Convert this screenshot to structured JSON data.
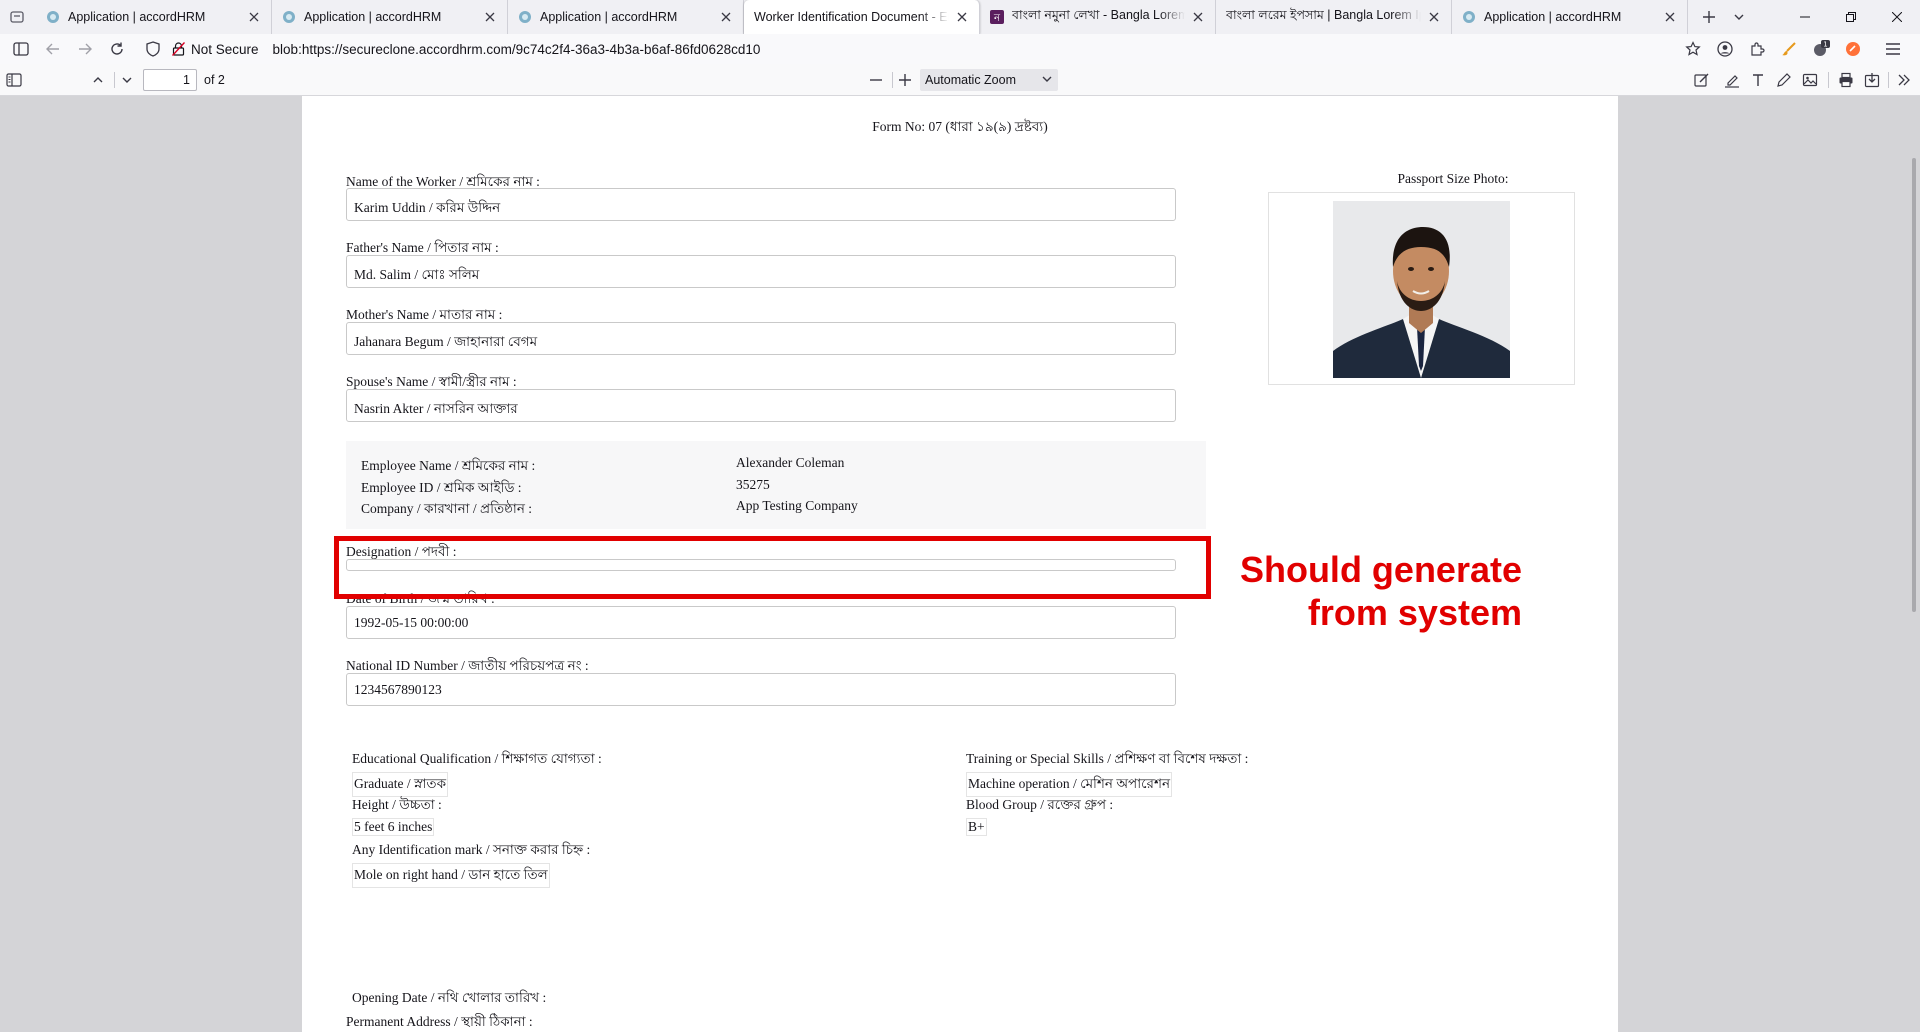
{
  "tabs": [
    {
      "title": "Application | accordHRM",
      "icon": "accordhrm-favicon-icon",
      "active": false
    },
    {
      "title": "Application | accordHRM",
      "icon": "accordhrm-favicon-icon",
      "active": false
    },
    {
      "title": "Application | accordHRM",
      "icon": "accordhrm-favicon-icon",
      "active": false
    },
    {
      "title": "Worker Identification Document - Emp",
      "icon": "",
      "active": true
    },
    {
      "title": "বাংলা নমুনা লেখা - Bangla Lorem I",
      "icon": "bangla-site-favicon-icon",
      "active": false
    },
    {
      "title": "বাংলা লরেম ইপসাম | Bangla Lorem Ip",
      "icon": "",
      "active": false
    },
    {
      "title": "Application | accordHRM",
      "icon": "accordhrm-favicon-icon",
      "active": false
    }
  ],
  "navbar": {
    "security_label": "Not Secure",
    "url": "blob:https://secureclone.accordhrm.com/9c74c2f4-36a3-4b3a-b6af-86fd0628cd10",
    "extension_badge": "1"
  },
  "pdf_toolbar": {
    "page_number": "1",
    "page_count": "of 2",
    "zoom": "Automatic Zoom"
  },
  "document": {
    "form_number": "Form No: 07 (ধারা ১৯(৯) দ্রষ্টব্য)",
    "worker_name_label": "Name of the Worker / শ্রমিকের নাম :",
    "worker_name": "Karim Uddin / করিম উদ্দিন",
    "father_label": "Father's Name / পিতার নাম :",
    "father_name": "Md. Salim / মোঃ সলিম",
    "mother_label": "Mother's Name / মাতার নাম :",
    "mother_name": "Jahanara Begum / জাহানারা বেগম",
    "spouse_label": "Spouse's Name / স্বামী/স্ত্রীর নাম :",
    "spouse_name": "Nasrin Akter / নাসরিন আক্তার",
    "photo_label": "Passport Size Photo:",
    "employee_name_label": "Employee Name / শ্রমিকের নাম :",
    "employee_name": "Alexander Coleman",
    "employee_id_label": "Employee ID / শ্রমিক আইডি :",
    "employee_id": "35275",
    "company_label": "Company / কারখানা / প্রতিষ্ঠান :",
    "company": "App Testing Company",
    "designation_label": "Designation / পদবী :",
    "designation": "",
    "dob_label": "Date of Birth / জন্ম তারিখ :",
    "dob": "1992-05-15 00:00:00",
    "nid_label": "National ID Number / জাতীয় পরিচয়পত্র নং :",
    "nid": "1234567890123",
    "education_label": "Educational Qualification / শিক্ষাগত যোগ্যতা :",
    "education": "Graduate / স্নাতক",
    "training_label": "Training or Special Skills / প্রশিক্ষণ বা বিশেষ দক্ষতা :",
    "training": "Machine operation / মেশিন অপারেশন",
    "height_label": "Height / উচ্চতা :",
    "height": "5 feet 6 inches",
    "blood_label": "Blood Group / রক্তের গ্রুপ :",
    "blood": "B+",
    "mark_label": "Any Identification mark / সনাক্ত করার চিহ্ন :",
    "mark": "Mole on right hand / ডান হাতে তিল",
    "opening_date_label": "Opening Date / নথি খোলার তারিখ :",
    "permanent_address_label": "Permanent Address / স্থায়ী ঠিকানা :"
  },
  "annotation": {
    "text": "Should generate from system",
    "color": "#e10000"
  },
  "colors": {
    "viewer_background": "#d4d4d7",
    "tabstrip_background": "#f0f0f4",
    "zoom_select_background": "#e6e6ea"
  }
}
